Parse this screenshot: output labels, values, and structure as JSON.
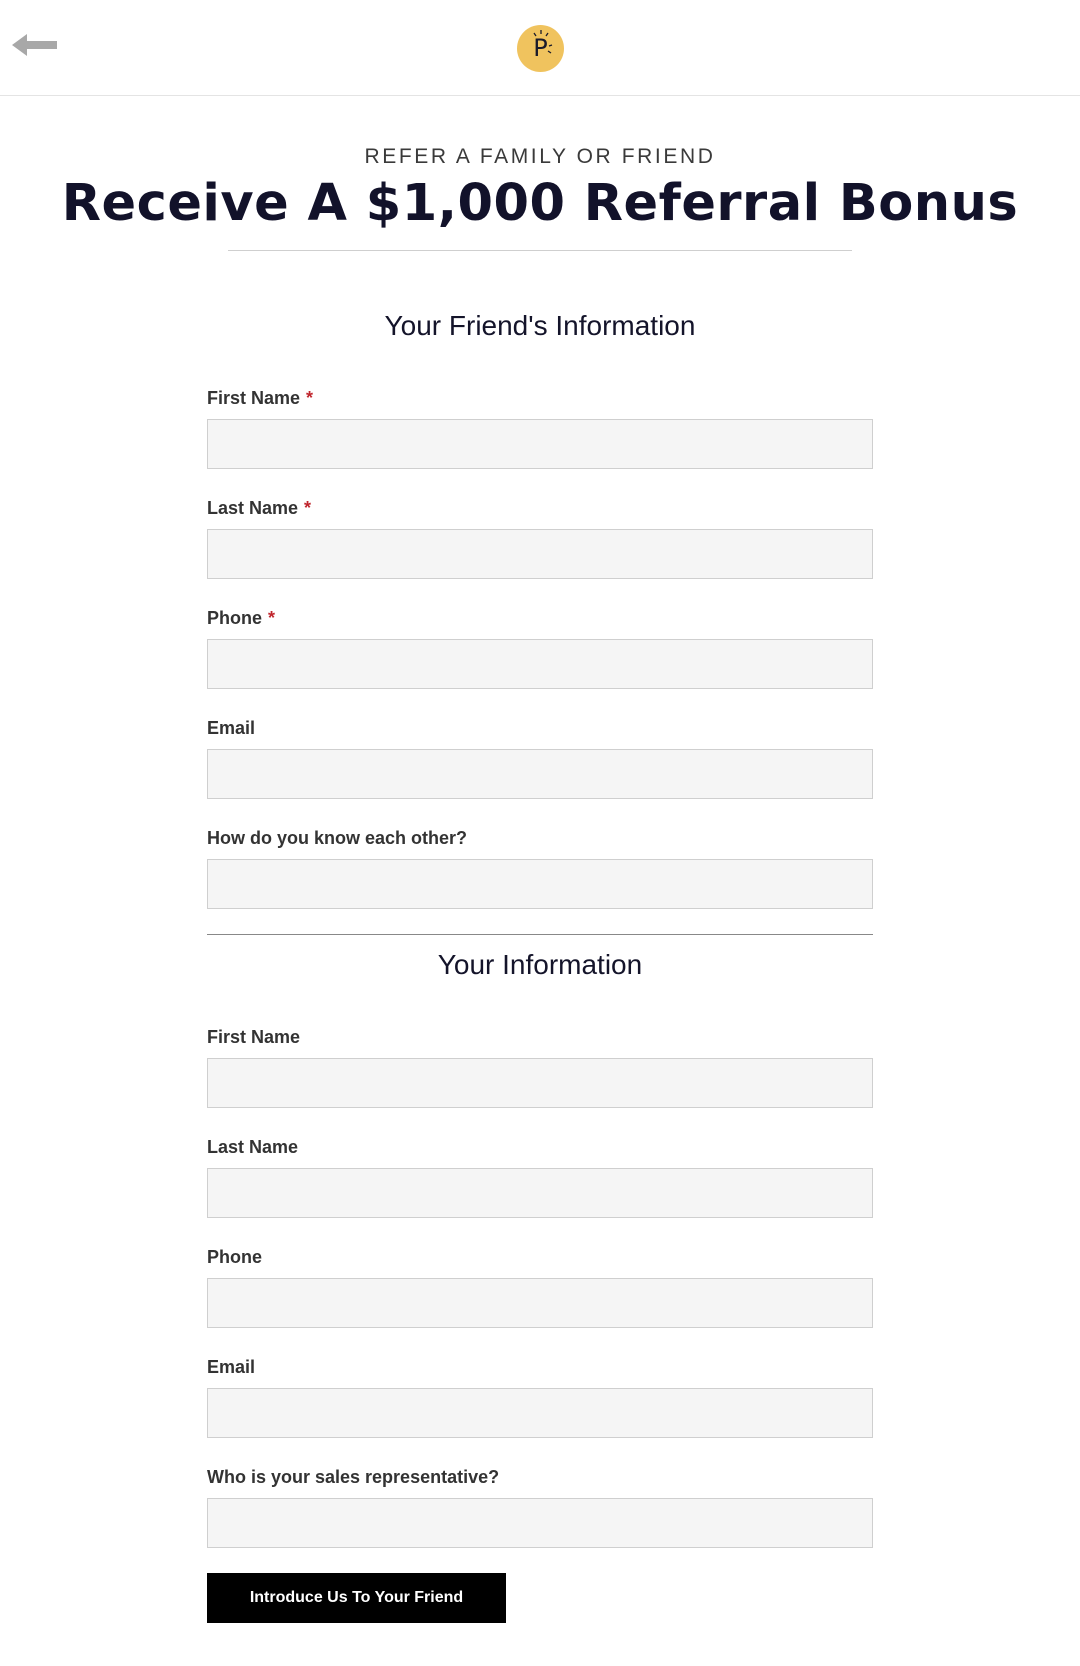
{
  "header": {
    "back_icon": "left-arrow-icon",
    "logo_letter": "P",
    "logo_color": "#f0c35e"
  },
  "hero": {
    "eyebrow": "REFER A FAMILY OR FRIEND",
    "headline": "Receive A $1,000 Referral Bonus"
  },
  "friend_section": {
    "title": "Your Friend's Information",
    "fields": [
      {
        "label": "First Name",
        "required": "*",
        "value": ""
      },
      {
        "label": "Last Name",
        "required": "*",
        "value": ""
      },
      {
        "label": "Phone",
        "required": "*",
        "value": ""
      },
      {
        "label": "Email",
        "value": ""
      },
      {
        "label": "How do you know each other?",
        "value": ""
      }
    ]
  },
  "your_section": {
    "title": "Your Information",
    "fields": [
      {
        "label": "First Name",
        "value": ""
      },
      {
        "label": "Last Name",
        "value": ""
      },
      {
        "label": "Phone",
        "value": ""
      },
      {
        "label": "Email",
        "value": ""
      },
      {
        "label": "Who is your sales representative?",
        "value": ""
      }
    ]
  },
  "submit": {
    "label": "Introduce Us To Your Friend"
  },
  "colors": {
    "required": "#c0262d",
    "headline": "#12122a",
    "button_bg": "#000000",
    "input_bg": "#f5f5f5"
  }
}
